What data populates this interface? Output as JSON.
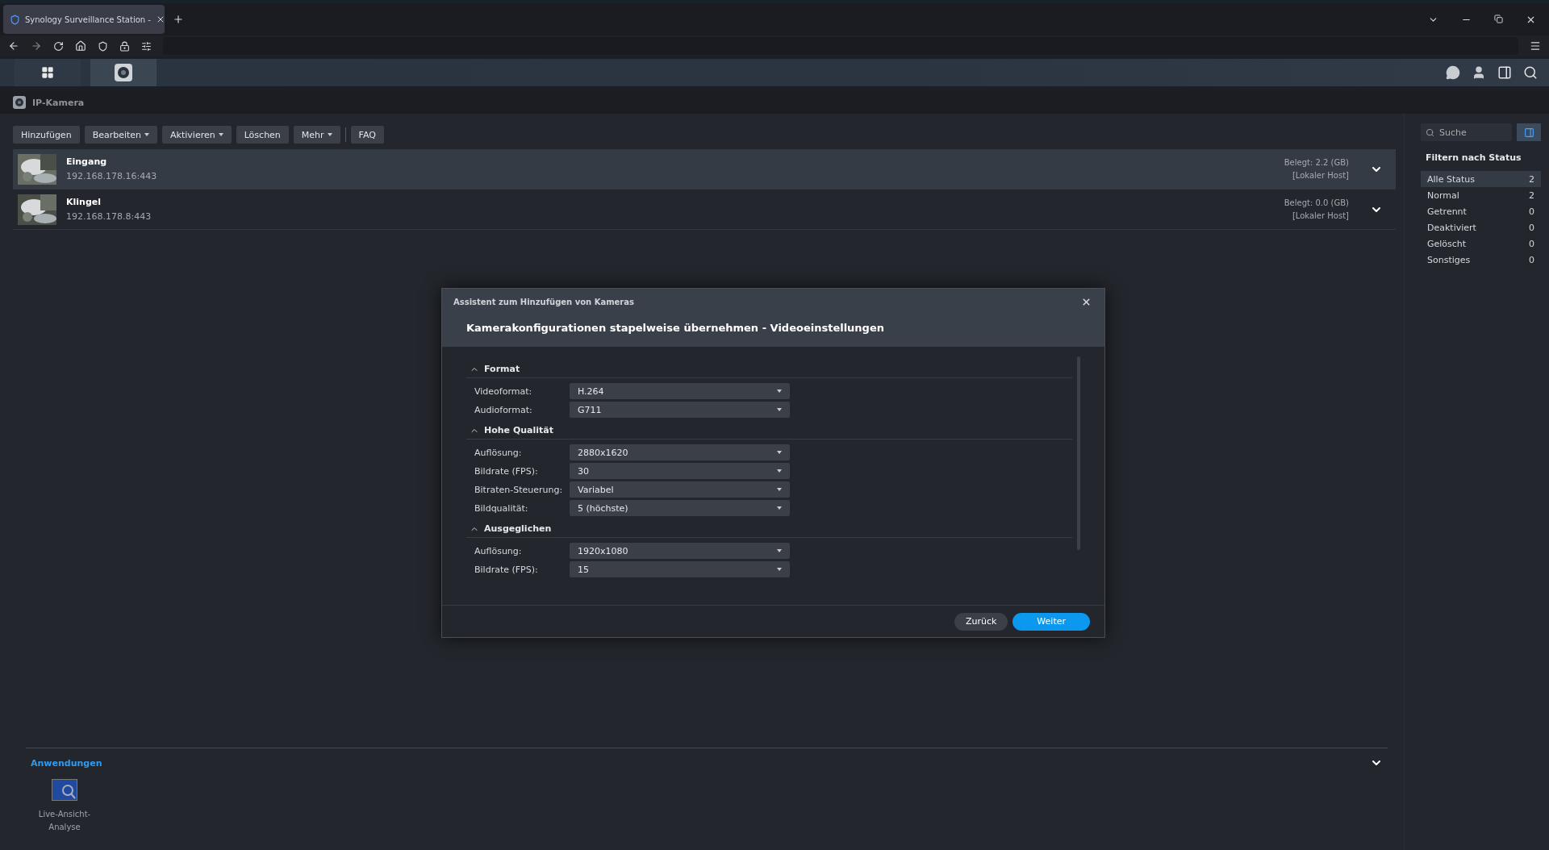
{
  "browser": {
    "tab_title": "Synology Surveillance Station -"
  },
  "app_window": {
    "title": "IP-Kamera"
  },
  "toolbar_groups": [
    {
      "buttons": [
        {
          "label": "Hinzufügen",
          "has_menu": false
        },
        {
          "label": "Bearbeiten",
          "has_menu": true
        },
        {
          "label": "Aktivieren",
          "has_menu": true
        },
        {
          "label": "Löschen",
          "has_menu": false
        },
        {
          "label": "Mehr",
          "has_menu": true
        }
      ]
    },
    {
      "buttons": [
        {
          "label": "FAQ",
          "has_menu": false
        }
      ]
    }
  ],
  "cameras": [
    {
      "name": "Eingang",
      "address": "192.168.178.16:443",
      "usage": "Belegt: 2.2 (GB)",
      "host": "[Lokaler Host]",
      "selected": true
    },
    {
      "name": "Klingel",
      "address": "192.168.178.8:443",
      "usage": "Belegt: 0.0 (GB)",
      "host": "[Lokaler Host]",
      "selected": false
    }
  ],
  "search": {
    "placeholder": "Suche"
  },
  "filter": {
    "title": "Filtern nach Status",
    "statuses": [
      {
        "label": "Alle Status",
        "count": "2",
        "selected": true
      },
      {
        "label": "Normal",
        "count": "2",
        "selected": false
      },
      {
        "label": "Getrennt",
        "count": "0",
        "selected": false
      },
      {
        "label": "Deaktiviert",
        "count": "0",
        "selected": false
      },
      {
        "label": "Gelöscht",
        "count": "0",
        "selected": false
      },
      {
        "label": "Sonstiges",
        "count": "0",
        "selected": false
      }
    ]
  },
  "dialog": {
    "window_title": "Assistent zum Hinzufügen von Kameras",
    "heading": "Kamerakonfigurationen stapelweise übernehmen - Videoeinstellungen",
    "sections": [
      {
        "title": "Format",
        "expanded": true,
        "fields": [
          {
            "label": "Videoformat:",
            "value": "H.264"
          },
          {
            "label": "Audioformat:",
            "value": "G711"
          }
        ]
      },
      {
        "title": "Hohe Qualität",
        "expanded": true,
        "fields": [
          {
            "label": "Auflösung:",
            "value": "2880x1620"
          },
          {
            "label": "Bildrate (FPS):",
            "value": "30"
          },
          {
            "label": "Bitraten-Steuerung:",
            "value": "Variabel"
          },
          {
            "label": "Bildqualität:",
            "value": "5 (höchste)"
          }
        ]
      },
      {
        "title": "Ausgeglichen",
        "expanded": true,
        "fields": [
          {
            "label": "Auflösung:",
            "value": "1920x1080"
          },
          {
            "label": "Bildrate (FPS):",
            "value": "15"
          }
        ]
      }
    ],
    "buttons": [
      {
        "label": "Zurück",
        "kind": "secondary"
      },
      {
        "label": "Weiter",
        "kind": "primary"
      }
    ]
  },
  "applications": {
    "title": "Anwendungen",
    "expanded": true,
    "items": [
      {
        "label": "Live-Ansicht-Analyse"
      }
    ]
  }
}
